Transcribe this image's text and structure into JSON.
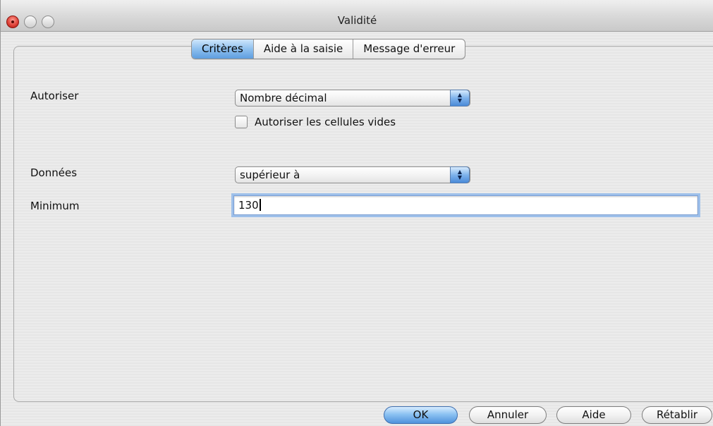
{
  "window": {
    "title": "Validité"
  },
  "tabs": [
    {
      "label": "Critères",
      "active": true
    },
    {
      "label": "Aide à la saisie",
      "active": false
    },
    {
      "label": "Message d'erreur",
      "active": false
    }
  ],
  "form": {
    "allow_label": "Autoriser",
    "allow_value": "Nombre décimal",
    "allow_empty_label": "Autoriser les cellules vides",
    "allow_empty_checked": false,
    "data_label": "Données",
    "data_value": "supérieur à",
    "minimum_label": "Minimum",
    "minimum_value": "130"
  },
  "buttons": {
    "ok": "OK",
    "cancel": "Annuler",
    "help": "Aide",
    "reset": "Rétablir"
  },
  "colors": {
    "accent": "#5e9ee0",
    "window_bg": "#ececec"
  },
  "icons": {
    "close": "close-button-icon",
    "minimize": "minimize-button-icon",
    "zoom": "zoom-button-icon",
    "select_arrows": "up-down-arrows-icon"
  }
}
